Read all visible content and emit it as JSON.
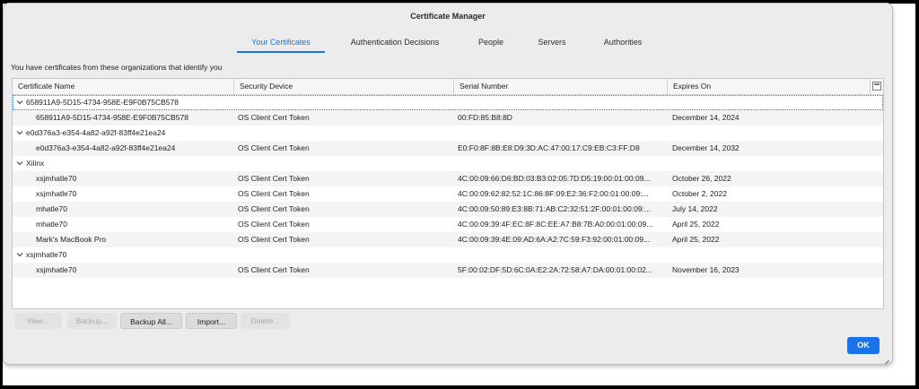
{
  "window": {
    "title": "Certificate Manager"
  },
  "tabs": [
    {
      "label": "Your Certificates",
      "active": true
    },
    {
      "label": "Authentication Decisions",
      "active": false
    },
    {
      "label": "People",
      "active": false
    },
    {
      "label": "Servers",
      "active": false
    },
    {
      "label": "Authorities",
      "active": false
    }
  ],
  "description": "You have certificates from these organizations that identify you",
  "table": {
    "columns": [
      "Certificate Name",
      "Security Device",
      "Serial Number",
      "Expires On"
    ],
    "column_picker_icon": "column-picker-icon",
    "rows": [
      {
        "type": "group",
        "name": "658911A9-5D15-4734-958E-E9F0B75CB578",
        "focused": true
      },
      {
        "type": "cert",
        "name": "658911A9-5D15-4734-958E-E9F0B75CB578",
        "device": "OS Client Cert Token",
        "serial": "00:FD:85:B8:8D",
        "expires": "December 14, 2024"
      },
      {
        "type": "group",
        "name": "e0d376a3-e354-4a82-a92f-83ff4e21ea24"
      },
      {
        "type": "cert",
        "name": "e0d376a3-e354-4a82-a92f-83ff4e21ea24",
        "device": "OS Client Cert Token",
        "serial": "E0:F0:8F:8B:E8:D9:3D:AC:47:00:17:C9:EB:C3:FF:D8",
        "expires": "December 14, 2032"
      },
      {
        "type": "group",
        "name": "Xilinx"
      },
      {
        "type": "cert",
        "name": "xsjmhatle70",
        "device": "OS Client Cert Token",
        "serial": "4C:00:09:66:D6:BD:03:B3:02:05:7D:D5:19:00:01:00:09...",
        "expires": "October 26, 2022"
      },
      {
        "type": "cert",
        "name": "xsjmhatle70",
        "device": "OS Client Cert Token",
        "serial": "4C:00:09:62:82:52:1C:86:8F:09:E2:36:F2:00:01:00:09:...",
        "expires": "October 2, 2022"
      },
      {
        "type": "cert",
        "name": "mhatle70",
        "device": "OS Client Cert Token",
        "serial": "4C:00:09:50:89:E3:8B:71:AB:C2:32:51:2F:00:01:00:09:...",
        "expires": "July 14, 2022"
      },
      {
        "type": "cert",
        "name": "mhatle70",
        "device": "OS Client Cert Token",
        "serial": "4C:00:09:39:4F:EC:8F:8C:EE:A7:B8:7B:A0:00:01:00:09...",
        "expires": "April 25, 2022"
      },
      {
        "type": "cert",
        "name": "Mark's MacBook Pro",
        "device": "OS Client Cert Token",
        "serial": "4C:00:09:39:4E:09:AD:6A:A2:7C:59:F3:92:00:01:00:09...",
        "expires": "April 25, 2022"
      },
      {
        "type": "group",
        "name": "xsjmhatle70"
      },
      {
        "type": "cert",
        "name": "xsjmhatle70",
        "device": "OS Client Cert Token",
        "serial": "5F:00:02:DF:5D:6C:0A:E2:2A:72:58:A7:DA:00:01:00:02...",
        "expires": "November 16, 2023"
      }
    ]
  },
  "buttons": [
    {
      "label": "View...",
      "enabled": false
    },
    {
      "label": "Backup...",
      "enabled": false
    },
    {
      "label": "Backup All...",
      "enabled": true
    },
    {
      "label": "Import...",
      "enabled": true
    },
    {
      "label": "Delete...",
      "enabled": false
    }
  ],
  "ok_label": "OK",
  "colors": {
    "accent": "#1a73e8",
    "window": "#ececec",
    "frame": "#000000"
  },
  "icons": {
    "group_expanded": "chevron-down-icon",
    "resize": "resize-grip-icon"
  }
}
